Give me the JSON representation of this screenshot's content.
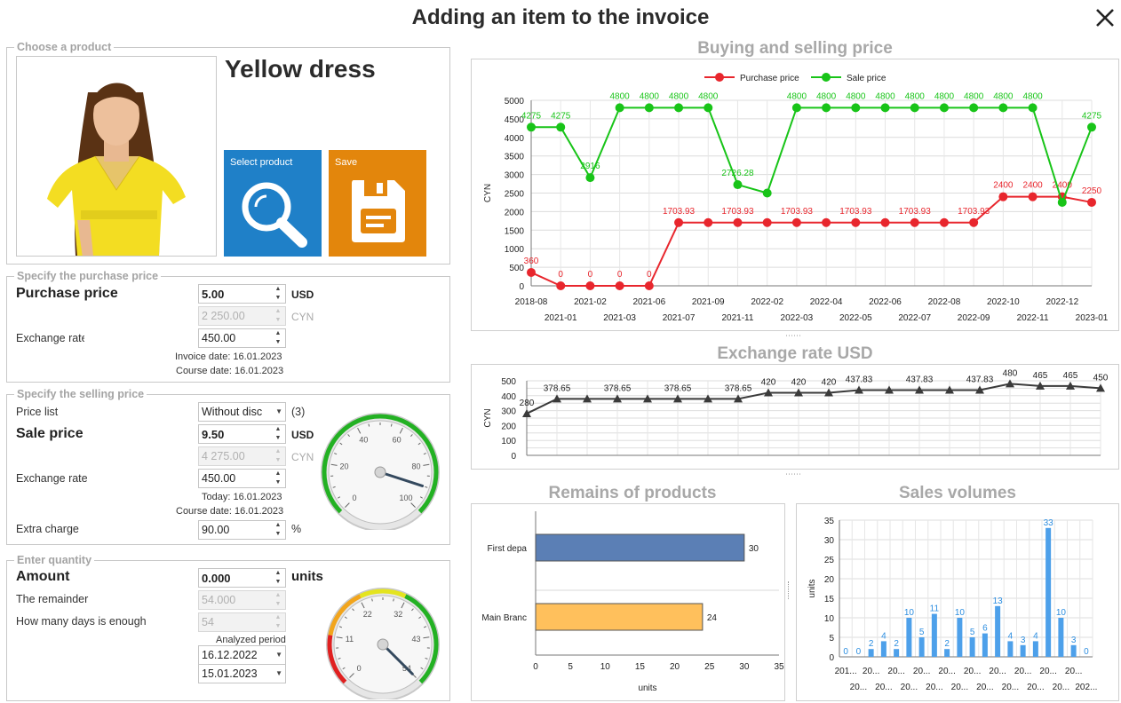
{
  "window": {
    "title": "Adding an item to the invoice"
  },
  "product": {
    "legend": "Choose a product",
    "name": "Yellow dress",
    "select_label": "Select product",
    "save_label": "Save"
  },
  "purchase": {
    "legend": "Specify the purchase price",
    "price_label": "Purchase price",
    "price_value": "5.00",
    "price_currency": "USD",
    "converted_value": "2 250.00",
    "converted_currency": "CYN",
    "rate_label": "Exchange rate",
    "rate_value": "450.00",
    "invoice_date": "Invoice date: 16.01.2023",
    "course_date": "Course date: 16.01.2023"
  },
  "selling": {
    "legend": "Specify the selling price",
    "price_list_label": "Price list",
    "price_list_value": "Without disc",
    "price_list_count": "(3)",
    "sale_label": "Sale price",
    "sale_value": "9.50",
    "sale_currency": "USD",
    "converted_value": "4 275.00",
    "converted_currency": "CYN",
    "rate_label": "Exchange rate",
    "rate_value": "450.00",
    "today": "Today: 16.01.2023",
    "course_date": "Course date: 16.01.2023",
    "charge_label": "Extra charge",
    "charge_value": "90.00",
    "charge_unit": "%",
    "gauge": {
      "min": 0,
      "max": 100,
      "value": 90,
      "ticks": [
        "0",
        "20",
        "40",
        "60",
        "80",
        "100"
      ]
    }
  },
  "quantity": {
    "legend": "Enter quantity",
    "amount_label": "Amount",
    "amount_value": "0.000",
    "amount_unit": "units",
    "remainder_label": "The remainder",
    "remainder_value": "54.000",
    "days_label": "How many days is enough",
    "days_value": "54",
    "period_label": "Analyzed period",
    "date_from": "16.12.2022",
    "date_to": "15.01.2023",
    "gauge": {
      "min": 0,
      "max": 54,
      "value": 54,
      "ticks": [
        "0",
        "11",
        "22",
        "32",
        "43",
        "54"
      ]
    }
  },
  "chart_data": [
    {
      "type": "line",
      "title": "Buying and selling price",
      "ylabel": "CYN",
      "ylim": [
        0,
        5000
      ],
      "yticks": [
        0,
        500,
        1000,
        1500,
        2000,
        2500,
        3000,
        3500,
        4000,
        4500,
        5000
      ],
      "x_top": [
        "2018-08",
        "2021-02",
        "2021-06",
        "2021-09",
        "2022-02",
        "2022-04",
        "2022-06",
        "2022-08",
        "2022-10",
        "2022-12"
      ],
      "x_bottom": [
        "2021-01",
        "2021-03",
        "2021-07",
        "2021-11",
        "2022-03",
        "2022-05",
        "2022-07",
        "2022-09",
        "2022-11",
        "2023-01"
      ],
      "legend": [
        "Purchase price",
        "Sale price"
      ],
      "series": [
        {
          "name": "Purchase price",
          "color": "#e8262d",
          "values": [
            360,
            0,
            0,
            0,
            0,
            1703.93,
            1703.93,
            1703.93,
            1703.93,
            1703.93,
            1703.93,
            1703.93,
            1703.93,
            1703.93,
            1703.93,
            1703.93,
            2400,
            2400,
            2400,
            2250
          ],
          "labels": [
            "360",
            "0",
            "0",
            "0",
            "0",
            "1703.93",
            "",
            "1703.93",
            "",
            "1703.93",
            "",
            "1703.93",
            "",
            "1703.93",
            "",
            "1703.93",
            "2400",
            "2400",
            "2400",
            "2250"
          ]
        },
        {
          "name": "Sale price",
          "color": "#18c418",
          "values": [
            4275,
            4275,
            2916,
            4800,
            4800,
            4800,
            4800,
            2726.28,
            2500,
            4800,
            4800,
            4800,
            4800,
            4800,
            4800,
            4800,
            4800,
            4800,
            2250,
            4275
          ],
          "labels": [
            "4275",
            "4275",
            "2916",
            "4800",
            "4800",
            "4800",
            "4800",
            "2726.28",
            "",
            "4800",
            "4800",
            "4800",
            "4800",
            "4800",
            "4800",
            "4800",
            "4800",
            "4800",
            "",
            "4275"
          ]
        }
      ]
    },
    {
      "type": "line",
      "title": "Exchange rate USD",
      "ylabel": "CYN",
      "ylim": [
        0,
        500
      ],
      "yticks": [
        0,
        100,
        200,
        300,
        400,
        500
      ],
      "series": [
        {
          "name": "",
          "color": "#3a3a3a",
          "values": [
            280,
            378.65,
            378.65,
            378.65,
            378.65,
            378.65,
            378.65,
            378.65,
            420,
            420,
            420,
            437.83,
            437.83,
            437.83,
            437.83,
            437.83,
            480,
            465,
            465,
            450
          ],
          "labels": [
            "280",
            "378.65",
            "",
            "378.65",
            "",
            "378.65",
            "",
            "378.65",
            "420",
            "420",
            "420",
            "437.83",
            "",
            "437.83",
            "",
            "437.83",
            "480",
            "465",
            "465",
            "450"
          ]
        }
      ]
    },
    {
      "type": "bar",
      "orientation": "horizontal",
      "title": "Remains of products",
      "categories": [
        "First depa",
        "Main Branc"
      ],
      "values": [
        30,
        24
      ],
      "colors": [
        "#5b7fb5",
        "#ffc05c"
      ],
      "xlabel": "units",
      "xlim": [
        0,
        35
      ],
      "xticks": [
        0,
        5,
        10,
        15,
        20,
        25,
        30,
        35
      ]
    },
    {
      "type": "bar",
      "title": "Sales volumes",
      "ylabel": "units",
      "ylim": [
        0,
        35
      ],
      "yticks": [
        0,
        5,
        10,
        15,
        20,
        25,
        30,
        35
      ],
      "values": [
        0,
        0,
        2,
        4,
        2,
        10,
        5,
        11,
        2,
        10,
        5,
        6,
        13,
        4,
        3,
        4,
        33,
        10,
        3,
        0
      ],
      "x_top": [
        "201...",
        "20...",
        "20...",
        "20...",
        "20...",
        "20...",
        "20...",
        "20...",
        "20...",
        "20..."
      ],
      "x_bottom": [
        "20...",
        "20...",
        "20...",
        "20...",
        "20...",
        "20...",
        "20...",
        "20...",
        "20...",
        "202..."
      ],
      "color": "#4da0ea"
    }
  ]
}
